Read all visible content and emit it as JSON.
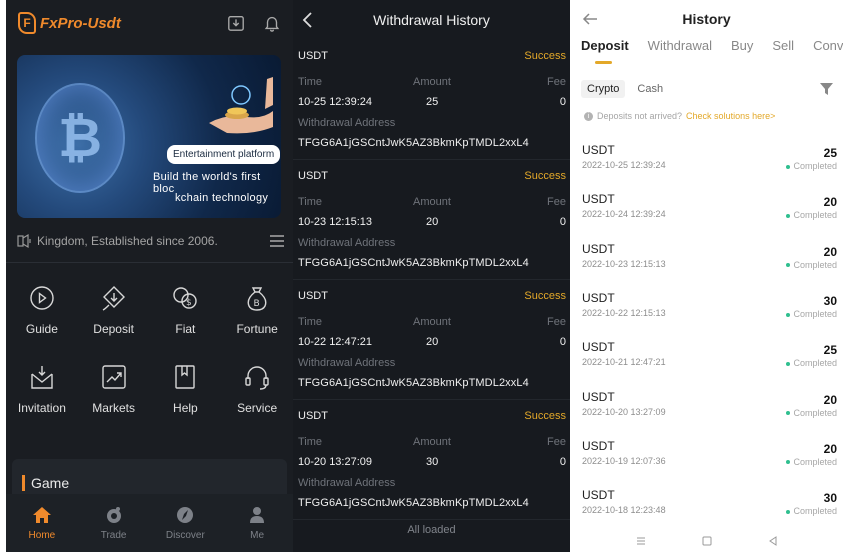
{
  "home": {
    "logo_text": "FxPro-Usdt",
    "banner": {
      "badge": "Entertainment platform",
      "line1": "Build the world's first bloc",
      "line2": "kchain technology"
    },
    "notice": "Kingdom, Established since 2006.",
    "grid": [
      {
        "label": "Guide",
        "icon": "play-circle-icon"
      },
      {
        "label": "Deposit",
        "icon": "deposit-icon"
      },
      {
        "label": "Fiat",
        "icon": "fiat-icon"
      },
      {
        "label": "Fortune",
        "icon": "money-bag-icon"
      },
      {
        "label": "Invitation",
        "icon": "invitation-icon"
      },
      {
        "label": "Markets",
        "icon": "chart-icon"
      },
      {
        "label": "Help",
        "icon": "book-icon"
      },
      {
        "label": "Service",
        "icon": "headset-icon"
      }
    ],
    "game_section": "Game",
    "tabs": [
      {
        "label": "Home",
        "icon": "home-icon",
        "active": true
      },
      {
        "label": "Trade",
        "icon": "trade-icon",
        "active": false
      },
      {
        "label": "Discover",
        "icon": "discover-icon",
        "active": false
      },
      {
        "label": "Me",
        "icon": "user-icon",
        "active": false
      }
    ],
    "accent_color": "#f08a2c"
  },
  "withdrawal": {
    "title": "Withdrawal History",
    "labels": {
      "time": "Time",
      "amount": "Amount",
      "fee": "Fee",
      "address": "Withdrawal Address"
    },
    "records": [
      {
        "coin": "USDT",
        "status": "Success",
        "time": "10-25 12:39:24",
        "amount": "25",
        "fee": "0",
        "address": "TFGG6A1jGSCntJwK5AZ3BkmKpTMDL2xxL4"
      },
      {
        "coin": "USDT",
        "status": "Success",
        "time": "10-23 12:15:13",
        "amount": "20",
        "fee": "0",
        "address": "TFGG6A1jGSCntJwK5AZ3BkmKpTMDL2xxL4"
      },
      {
        "coin": "USDT",
        "status": "Success",
        "time": "10-22 12:47:21",
        "amount": "20",
        "fee": "0",
        "address": "TFGG6A1jGSCntJwK5AZ3BkmKpTMDL2xxL4"
      },
      {
        "coin": "USDT",
        "status": "Success",
        "time": "10-20 13:27:09",
        "amount": "30",
        "fee": "0",
        "address": "TFGG6A1jGSCntJwK5AZ3BkmKpTMDL2xxL4"
      }
    ],
    "footer": "All loaded",
    "status_color": "#e3a829"
  },
  "history": {
    "title": "History",
    "tabs": [
      "Deposit",
      "Withdrawal",
      "Buy",
      "Sell",
      "Conver"
    ],
    "active_tab": "Deposit",
    "segments": [
      "Crypto",
      "Cash"
    ],
    "active_segment": "Crypto",
    "hint": "Deposits not arrived?",
    "hint_link": "Check solutions here>",
    "items": [
      {
        "coin": "USDT",
        "datetime": "2022-10-25 12:39:24",
        "amount": "25",
        "status": "Completed"
      },
      {
        "coin": "USDT",
        "datetime": "2022-10-24 12:39:24",
        "amount": "20",
        "status": "Completed"
      },
      {
        "coin": "USDT",
        "datetime": "2022-10-23 12:15:13",
        "amount": "20",
        "status": "Completed"
      },
      {
        "coin": "USDT",
        "datetime": "2022-10-22 12:15:13",
        "amount": "30",
        "status": "Completed"
      },
      {
        "coin": "USDT",
        "datetime": "2022-10-21 12:47:21",
        "amount": "25",
        "status": "Completed"
      },
      {
        "coin": "USDT",
        "datetime": "2022-10-20 13:27:09",
        "amount": "20",
        "status": "Completed"
      },
      {
        "coin": "USDT",
        "datetime": "2022-10-19 12:07:36",
        "amount": "20",
        "status": "Completed"
      },
      {
        "coin": "USDT",
        "datetime": "2022-10-18 12:23:48",
        "amount": "30",
        "status": "Completed"
      }
    ],
    "accent_color": "#e3a829",
    "complete_dot_color": "#2fbf8f"
  }
}
